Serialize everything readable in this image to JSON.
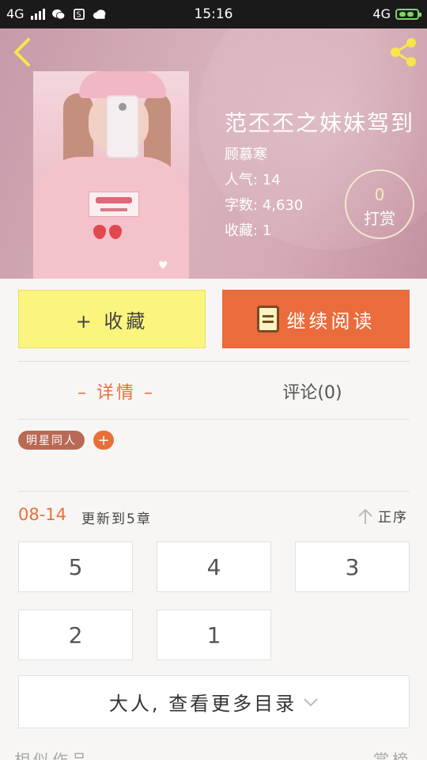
{
  "statusbar": {
    "network_left": "4G",
    "time": "15:16",
    "network_right": "4G"
  },
  "book": {
    "title": "范丕丕之妹妹驾到",
    "author": "顾慕寒",
    "popularity": "人气: 14",
    "word_count": "字数: 4,630",
    "favorites": "收藏: 1"
  },
  "tip": {
    "count": "0",
    "label": "打赏"
  },
  "actions": {
    "favorite_label": "+ 收藏",
    "read_label": "继续阅读"
  },
  "tabs": {
    "detail": "– 详情 –",
    "comments": "评论(0)"
  },
  "tags": [
    {
      "label": "明星同人"
    }
  ],
  "tag_add": "+",
  "updates": {
    "date": "08-14",
    "text": "更新到5章",
    "sort_label": "正序"
  },
  "chapters": [
    "5",
    "4",
    "3",
    "2",
    "1"
  ],
  "more_catalog": "大人, 查看更多目录",
  "footer": {
    "left": "相似作品",
    "right": "赏榜"
  },
  "colors": {
    "accent": "#e86f3a",
    "favorite_button": "#fbf57e",
    "read_button": "#ea6b3b",
    "tag": "#b86a54"
  }
}
